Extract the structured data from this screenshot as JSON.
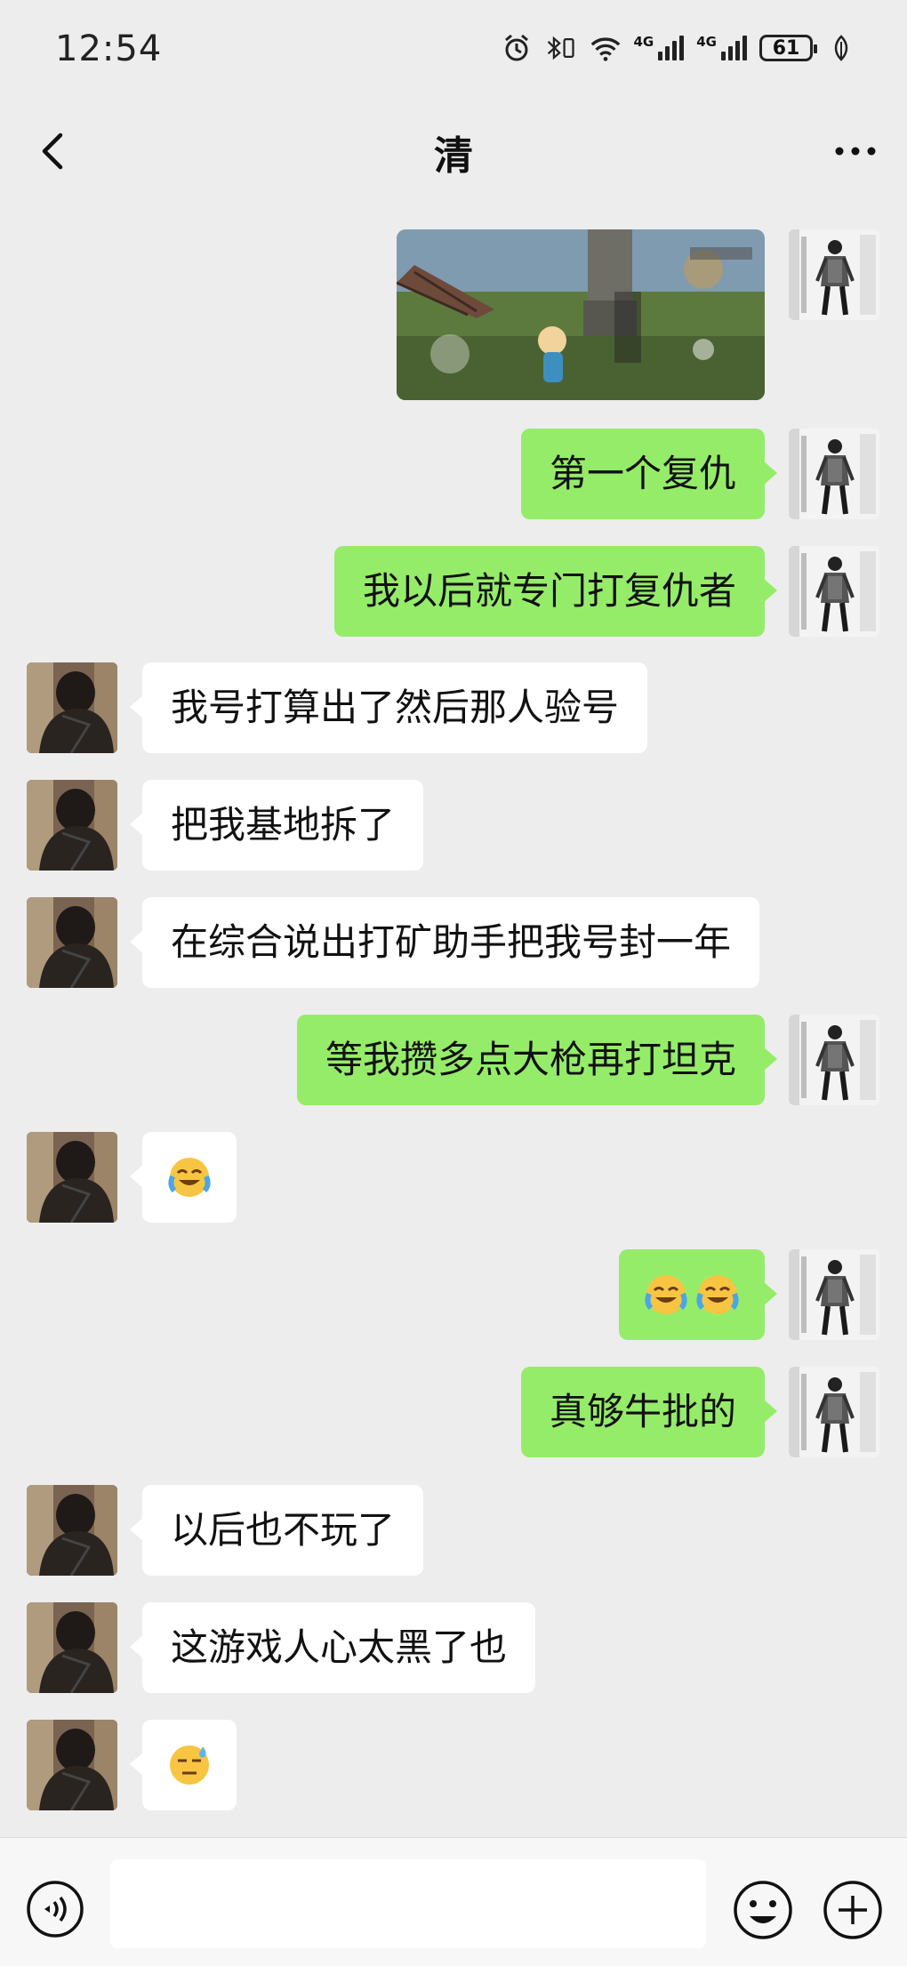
{
  "status_bar": {
    "time": "12:54",
    "network1": "4G",
    "network2": "4G",
    "battery": "61"
  },
  "header": {
    "title": "清"
  },
  "messages": {
    "m1": "第一个复仇",
    "m2": "我以后就专门打复仇者",
    "m3": "我号打算出了然后那人验号",
    "m4": "把我基地拆了",
    "m5": "在综合说出打矿助手把我号封一年",
    "m6": "等我攒多点大枪再打坦克",
    "m10": "真够牛批的",
    "m11": "以后也不玩了",
    "m12": "这游戏人心太黑了也"
  },
  "emoji_messages": {
    "m7": "loudly-crying-laughing",
    "m8": "loudly-crying-laughing x2",
    "m13": "sweat-face"
  },
  "input": {
    "placeholder": ""
  },
  "colors": {
    "background": "#ededed",
    "my_bubble": "#95ec69",
    "their_bubble": "#ffffff"
  }
}
